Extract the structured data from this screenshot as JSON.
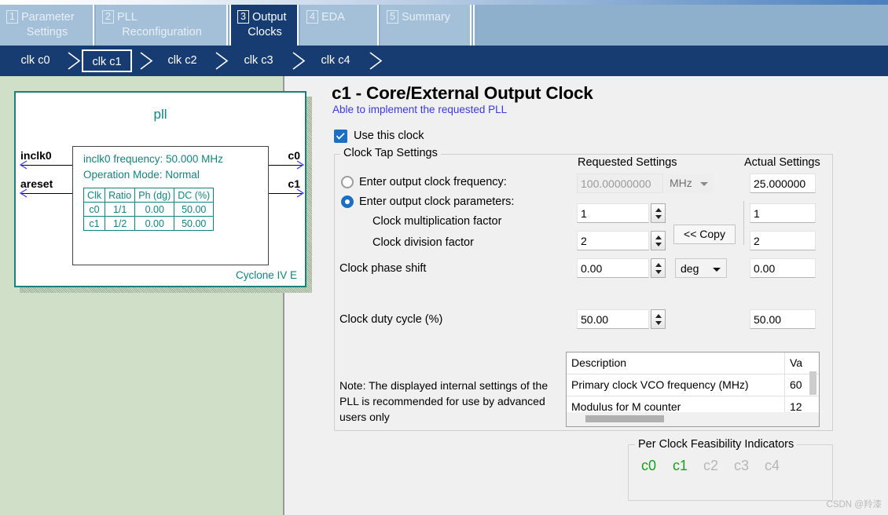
{
  "wizard": {
    "tabs": [
      {
        "num": "1",
        "line1": "Parameter",
        "line2": "Settings",
        "active": false
      },
      {
        "num": "2",
        "line1": "PLL",
        "line2": "Reconfiguration",
        "active": false
      },
      {
        "num": "3",
        "line1": "Output",
        "line2": "Clocks",
        "active": true
      },
      {
        "num": "4",
        "line1": "EDA",
        "line2": "",
        "active": false
      },
      {
        "num": "5",
        "line1": "Summary",
        "line2": "",
        "active": false
      }
    ]
  },
  "subnav": {
    "items": [
      {
        "label": "clk c0",
        "selected": false
      },
      {
        "label": "clk c1",
        "selected": true
      },
      {
        "label": "clk c2",
        "selected": false
      },
      {
        "label": "clk c3",
        "selected": false
      },
      {
        "label": "clk c4",
        "selected": false
      }
    ]
  },
  "block_diagram": {
    "title": "pll",
    "inputs": [
      "inclk0",
      "areset"
    ],
    "outputs": [
      "c0",
      "c1"
    ],
    "info_line1": "inclk0 frequency: 50.000 MHz",
    "info_line2": "Operation Mode: Normal",
    "table_headers": [
      "Clk",
      "Ratio",
      "Ph (dg)",
      "DC (%)"
    ],
    "table_rows": [
      [
        "c0",
        "1/1",
        "0.00",
        "50.00"
      ],
      [
        "c1",
        "1/2",
        "0.00",
        "50.00"
      ]
    ],
    "device": "Cyclone IV E"
  },
  "page": {
    "title": "c1 - Core/External Output Clock",
    "subtitle": "Able to implement the requested PLL",
    "use_clock_label": "Use this clock",
    "use_clock_checked": true
  },
  "clock_tap": {
    "group_title": "Clock Tap Settings",
    "col_requested": "Requested Settings",
    "col_actual": "Actual Settings",
    "freq_radio_label": "Enter output clock frequency:",
    "freq_requested_value": "100.00000000",
    "freq_unit": "MHz",
    "freq_actual_value": "25.000000",
    "params_radio_label": "Enter output clock parameters:",
    "mult_label": "Clock multiplication factor",
    "mult_requested": "1",
    "mult_actual": "1",
    "div_label": "Clock division factor",
    "div_requested": "2",
    "div_actual": "2",
    "copy_button": "<< Copy",
    "phase_label": "Clock phase shift",
    "phase_requested": "0.00",
    "phase_unit": "deg",
    "phase_actual": "0.00",
    "duty_label": "Clock duty cycle (%)",
    "duty_requested": "50.00",
    "duty_actual": "50.00",
    "note": "Note: The displayed internal settings of the PLL is recommended for use by advanced users only",
    "desc_table": {
      "headers": [
        "Description",
        "Va"
      ],
      "rows": [
        {
          "description": "Primary clock VCO frequency (MHz)",
          "value": "60"
        },
        {
          "description": "Modulus for M counter",
          "value": "12"
        }
      ]
    }
  },
  "feasibility": {
    "title": "Per Clock Feasibility Indicators",
    "items": [
      {
        "label": "c0",
        "state": "ok"
      },
      {
        "label": "c1",
        "state": "ok"
      },
      {
        "label": "c2",
        "state": "off"
      },
      {
        "label": "c3",
        "state": "off"
      },
      {
        "label": "c4",
        "state": "off"
      }
    ]
  },
  "watermark": "CSDN @羚漆",
  "colors": {
    "accent_dark": "#173c72",
    "tab_inactive": "#a3c0d8",
    "panel_green": "#cfdfc8",
    "teal": "#11837f",
    "link_blue": "#3b38e0",
    "ok_green": "#17a01c"
  }
}
